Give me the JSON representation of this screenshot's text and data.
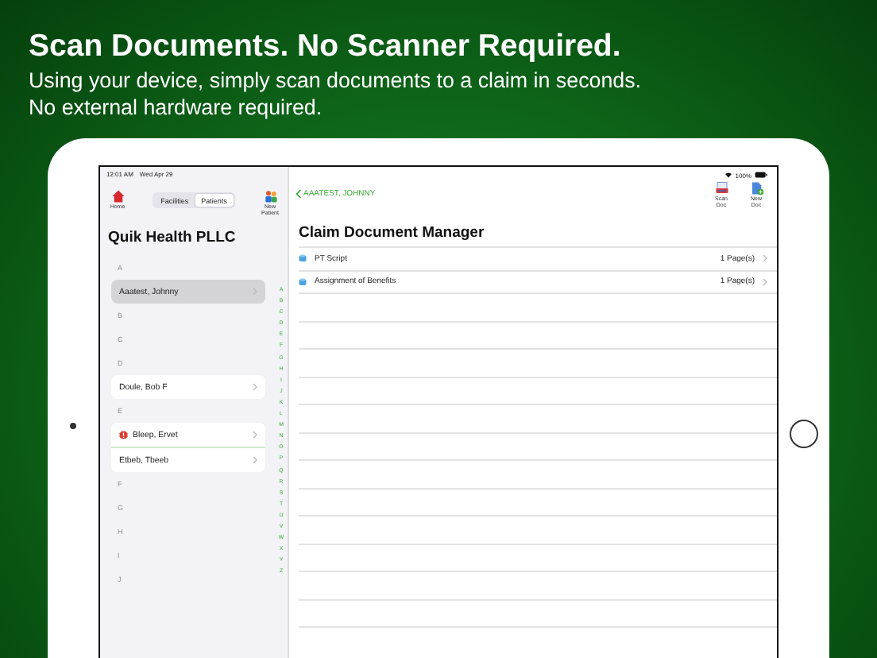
{
  "headline": "Scan Documents. No Scanner Required.",
  "subtitle_lines": [
    "Using your device, simply scan documents to a claim in seconds.",
    "No external hardware required."
  ],
  "status_bar": {
    "time": "12:01 AM",
    "date": "Wed Apr 29",
    "battery": "100%"
  },
  "sidebar": {
    "home_label": "Home",
    "segments": [
      {
        "label": "Facilities",
        "selected": false
      },
      {
        "label": "Patients",
        "selected": true
      }
    ],
    "new_patient_label": "New Patient",
    "title": "Quik Health PLLC",
    "sections": [
      {
        "letter": "A",
        "patients": [
          {
            "name": "Aaatest, Johnny",
            "selected": true,
            "flagged": false
          }
        ]
      },
      {
        "letter": "B"
      },
      {
        "letter": "C"
      },
      {
        "letter": "D",
        "patients": [
          {
            "name": "Doule, Bob F",
            "selected": false,
            "flagged": false
          }
        ]
      },
      {
        "letter": "E",
        "patients": [
          {
            "name": "Bleep, Ervet",
            "selected": false,
            "flagged": true
          },
          {
            "name": "Etbeb, Tbeeb",
            "selected": false,
            "flagged": false
          }
        ]
      },
      {
        "letter": "F"
      },
      {
        "letter": "G"
      },
      {
        "letter": "H"
      },
      {
        "letter": "I"
      },
      {
        "letter": "J"
      }
    ],
    "index": [
      "A",
      "B",
      "C",
      "D",
      "E",
      "F",
      "G",
      "H",
      "I",
      "J",
      "K",
      "L",
      "M",
      "N",
      "O",
      "P",
      "Q",
      "R",
      "S",
      "T",
      "U",
      "V",
      "W",
      "X",
      "Y",
      "Z"
    ]
  },
  "detail": {
    "back_label": "AAATEST, JOHNNY",
    "toolbar": [
      {
        "kind": "scan",
        "label": "Scan Doc"
      },
      {
        "kind": "new",
        "label": "New Doc"
      }
    ],
    "title": "Claim Document Manager",
    "documents": [
      {
        "name": "PT Script",
        "pages": "1 Page(s)"
      },
      {
        "name": "Assignment of Benefits",
        "pages": "1 Page(s)"
      }
    ]
  }
}
